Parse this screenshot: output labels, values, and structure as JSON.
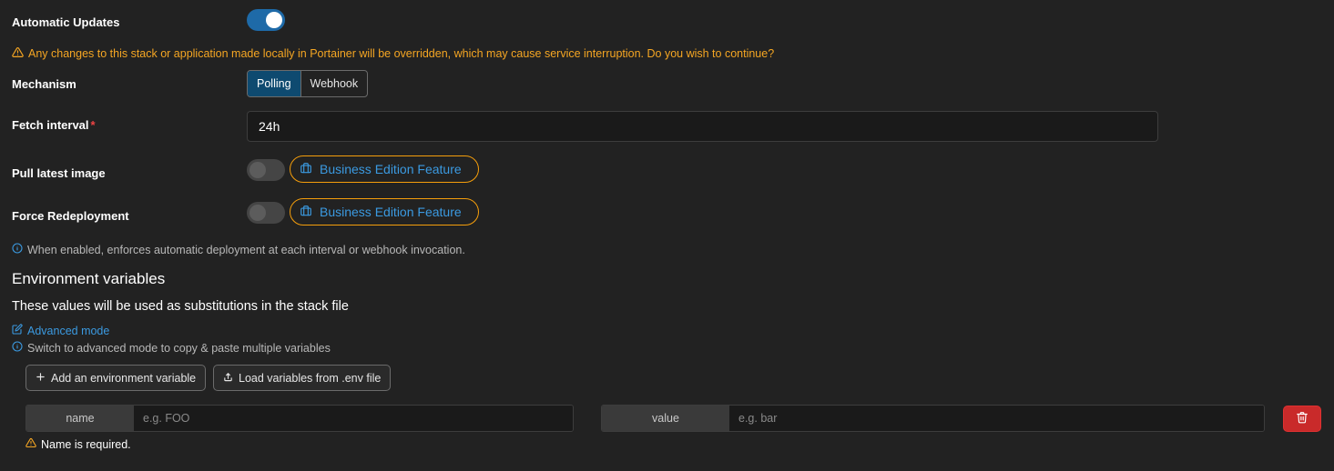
{
  "auto_updates": {
    "label": "Automatic Updates",
    "enabled": true
  },
  "warning": {
    "icon": "warning-triangle-icon",
    "text": "Any changes to this stack or application made locally in Portainer will be overridden, which may cause service interruption. Do you wish to continue?",
    "color": "#f5a623"
  },
  "mechanism": {
    "label": "Mechanism",
    "options": [
      "Polling",
      "Webhook"
    ],
    "selected": "Polling"
  },
  "fetch_interval": {
    "label": "Fetch interval",
    "required_mark": "*",
    "value": "24h"
  },
  "pull_latest": {
    "label": "Pull latest image",
    "enabled": false,
    "badge": "Business Edition Feature"
  },
  "force_redeploy": {
    "label": "Force Redeployment",
    "enabled": false,
    "badge": "Business Edition Feature"
  },
  "redeploy_info": "When enabled, enforces automatic deployment at each interval or webhook invocation.",
  "env": {
    "title": "Environment variables",
    "subtitle": "These values will be used as substitutions in the stack file",
    "advanced_link": "Advanced mode",
    "advanced_info": "Switch to advanced mode to copy & paste multiple variables",
    "add_button": "Add an environment variable",
    "load_button": "Load variables from .env file",
    "row": {
      "name_label": "name",
      "name_placeholder": "e.g. FOO",
      "value_label": "value",
      "value_placeholder": "e.g. bar"
    },
    "error": "Name is required."
  },
  "colors": {
    "accent": "#1e6aa8",
    "link": "#3b9ae1",
    "danger": "#c92a2a",
    "badge_border": "#f59e0b"
  }
}
